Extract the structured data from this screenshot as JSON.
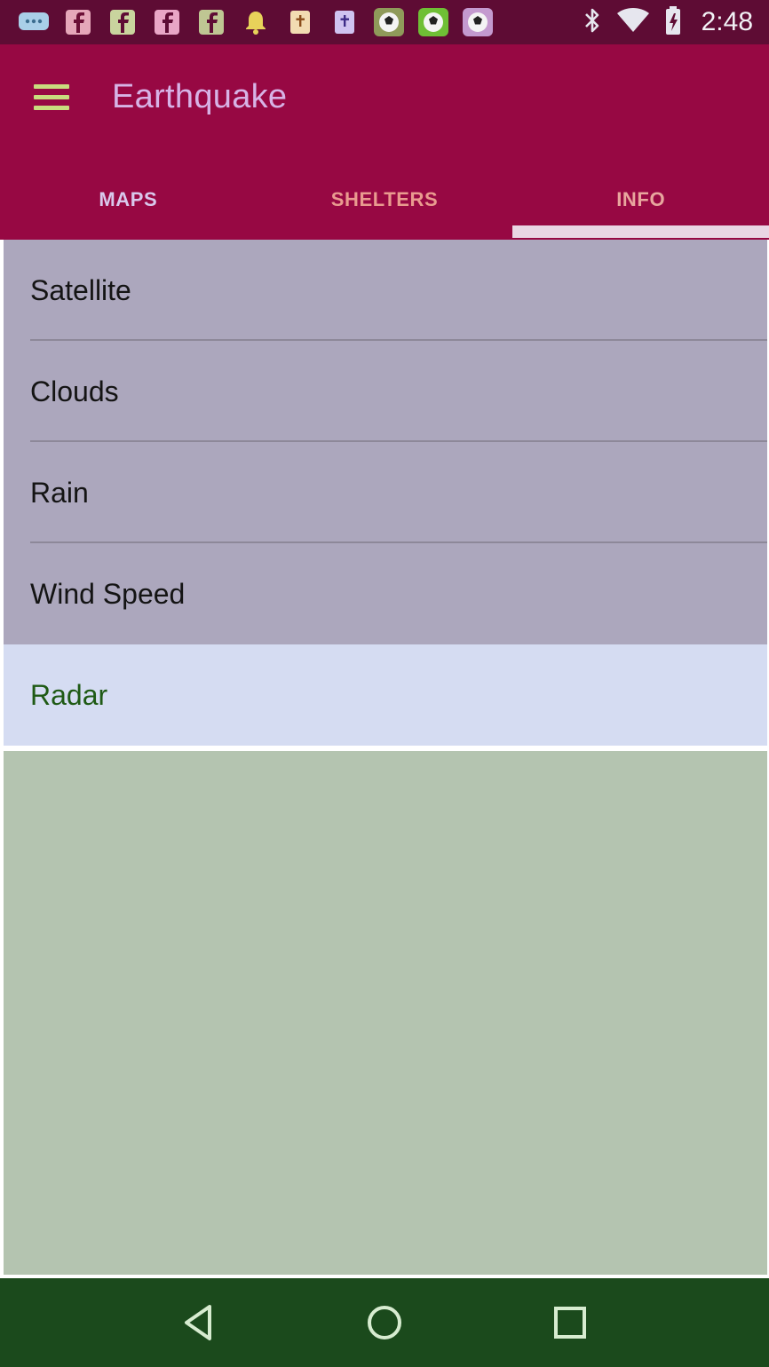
{
  "status_bar": {
    "time": "2:48",
    "notification_icons": [
      "chat-bubble-icon",
      "facebook-icon",
      "facebook-icon",
      "facebook-icon",
      "facebook-icon",
      "bell-icon",
      "bible-icon",
      "bible-icon",
      "soccer-ball-icon",
      "soccer-ball-icon",
      "soccer-ball-icon"
    ],
    "system_icons": [
      "bluetooth-icon",
      "wifi-icon",
      "battery-icon"
    ]
  },
  "app_bar": {
    "title": "Earthquake",
    "menu_icon": "hamburger-menu-icon"
  },
  "tabs": [
    {
      "label": "MAPS",
      "selected": false
    },
    {
      "label": "SHELTERS",
      "selected": false
    },
    {
      "label": "INFO",
      "selected": true
    }
  ],
  "map_types": [
    {
      "label": "Satellite",
      "selected": false
    },
    {
      "label": "Clouds",
      "selected": false
    },
    {
      "label": "Rain",
      "selected": false
    },
    {
      "label": "Wind Speed",
      "selected": false
    },
    {
      "label": "Radar",
      "selected": true
    }
  ],
  "nav_bar": {
    "buttons": [
      "back-icon",
      "home-icon",
      "recents-icon"
    ]
  },
  "colors": {
    "status_bar": "#5e0c34",
    "app_bar": "#970843",
    "list_background": "#aca7bd",
    "list_selected": "#d5dcf2",
    "content_background": "#b4c4b0",
    "nav_bar": "#1b4a1c"
  }
}
